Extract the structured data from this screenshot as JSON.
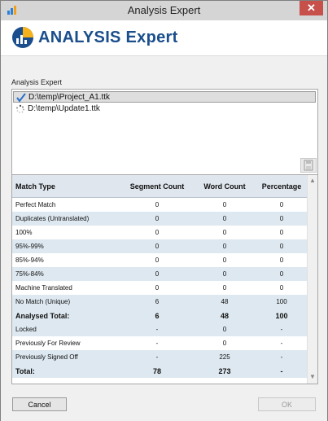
{
  "window": {
    "title": "Analysis Expert",
    "close_label": "✕"
  },
  "header": {
    "brand_text": "ANALYSIS Expert"
  },
  "files": {
    "label": "Analysis Expert",
    "items": [
      {
        "name": "D:\\temp\\Project_A1.ttk",
        "status": "done",
        "selected": true
      },
      {
        "name": "D:\\temp\\Update1.ttk",
        "status": "loading",
        "selected": false
      }
    ]
  },
  "table": {
    "headers": [
      "Match Type",
      "Segment Count",
      "Word Count",
      "Percentage"
    ],
    "rows": [
      [
        "Perfect Match",
        "0",
        "0",
        "0"
      ],
      [
        "Duplicates (Untranslated)",
        "0",
        "0",
        "0"
      ],
      [
        "100%",
        "0",
        "0",
        "0"
      ],
      [
        "95%-99%",
        "0",
        "0",
        "0"
      ],
      [
        "85%-94%",
        "0",
        "0",
        "0"
      ],
      [
        "75%-84%",
        "0",
        "0",
        "0"
      ],
      [
        "Machine Translated",
        "0",
        "0",
        "0"
      ],
      [
        "No Match (Unique)",
        "6",
        "48",
        "100"
      ],
      [
        "Analysed Total:",
        "6",
        "48",
        "100"
      ],
      [
        "Locked",
        "-",
        "0",
        "-"
      ],
      [
        "Previously For Review",
        "-",
        "0",
        "-"
      ],
      [
        "Previously Signed Off",
        "-",
        "225",
        "-"
      ],
      [
        "Total:",
        "78",
        "273",
        "-"
      ]
    ],
    "bold_rows": [
      8,
      12
    ]
  },
  "buttons": {
    "cancel": "Cancel",
    "ok": "OK"
  },
  "colors": {
    "brand": "#1a4e8c",
    "row_alt": "#dde8f0",
    "header_bg": "#dfe6ee",
    "close_bg": "#c7504b"
  }
}
